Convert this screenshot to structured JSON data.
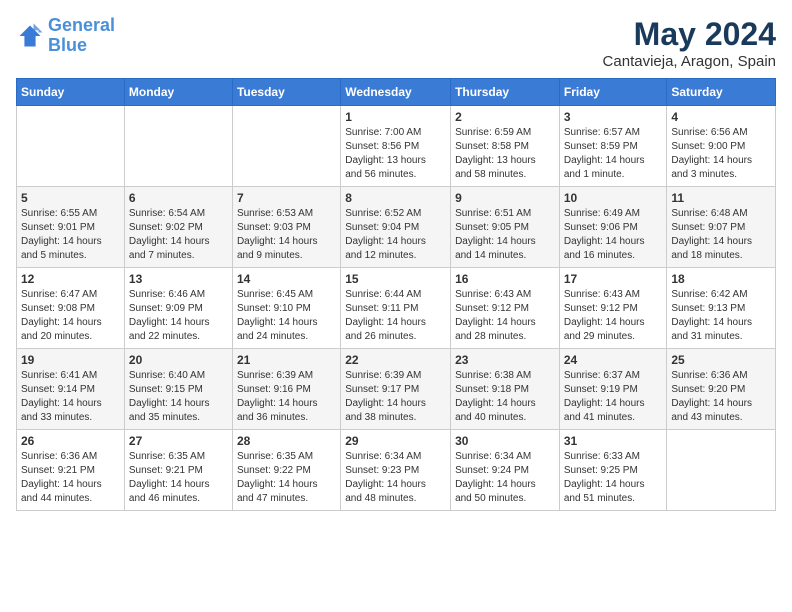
{
  "header": {
    "logo_line1": "General",
    "logo_line2": "Blue",
    "month_title": "May 2024",
    "location": "Cantavieja, Aragon, Spain"
  },
  "days_of_week": [
    "Sunday",
    "Monday",
    "Tuesday",
    "Wednesday",
    "Thursday",
    "Friday",
    "Saturday"
  ],
  "weeks": [
    [
      {
        "day": "",
        "info": ""
      },
      {
        "day": "",
        "info": ""
      },
      {
        "day": "",
        "info": ""
      },
      {
        "day": "1",
        "info": "Sunrise: 7:00 AM\nSunset: 8:56 PM\nDaylight: 13 hours\nand 56 minutes."
      },
      {
        "day": "2",
        "info": "Sunrise: 6:59 AM\nSunset: 8:58 PM\nDaylight: 13 hours\nand 58 minutes."
      },
      {
        "day": "3",
        "info": "Sunrise: 6:57 AM\nSunset: 8:59 PM\nDaylight: 14 hours\nand 1 minute."
      },
      {
        "day": "4",
        "info": "Sunrise: 6:56 AM\nSunset: 9:00 PM\nDaylight: 14 hours\nand 3 minutes."
      }
    ],
    [
      {
        "day": "5",
        "info": "Sunrise: 6:55 AM\nSunset: 9:01 PM\nDaylight: 14 hours\nand 5 minutes."
      },
      {
        "day": "6",
        "info": "Sunrise: 6:54 AM\nSunset: 9:02 PM\nDaylight: 14 hours\nand 7 minutes."
      },
      {
        "day": "7",
        "info": "Sunrise: 6:53 AM\nSunset: 9:03 PM\nDaylight: 14 hours\nand 9 minutes."
      },
      {
        "day": "8",
        "info": "Sunrise: 6:52 AM\nSunset: 9:04 PM\nDaylight: 14 hours\nand 12 minutes."
      },
      {
        "day": "9",
        "info": "Sunrise: 6:51 AM\nSunset: 9:05 PM\nDaylight: 14 hours\nand 14 minutes."
      },
      {
        "day": "10",
        "info": "Sunrise: 6:49 AM\nSunset: 9:06 PM\nDaylight: 14 hours\nand 16 minutes."
      },
      {
        "day": "11",
        "info": "Sunrise: 6:48 AM\nSunset: 9:07 PM\nDaylight: 14 hours\nand 18 minutes."
      }
    ],
    [
      {
        "day": "12",
        "info": "Sunrise: 6:47 AM\nSunset: 9:08 PM\nDaylight: 14 hours\nand 20 minutes."
      },
      {
        "day": "13",
        "info": "Sunrise: 6:46 AM\nSunset: 9:09 PM\nDaylight: 14 hours\nand 22 minutes."
      },
      {
        "day": "14",
        "info": "Sunrise: 6:45 AM\nSunset: 9:10 PM\nDaylight: 14 hours\nand 24 minutes."
      },
      {
        "day": "15",
        "info": "Sunrise: 6:44 AM\nSunset: 9:11 PM\nDaylight: 14 hours\nand 26 minutes."
      },
      {
        "day": "16",
        "info": "Sunrise: 6:43 AM\nSunset: 9:12 PM\nDaylight: 14 hours\nand 28 minutes."
      },
      {
        "day": "17",
        "info": "Sunrise: 6:43 AM\nSunset: 9:12 PM\nDaylight: 14 hours\nand 29 minutes."
      },
      {
        "day": "18",
        "info": "Sunrise: 6:42 AM\nSunset: 9:13 PM\nDaylight: 14 hours\nand 31 minutes."
      }
    ],
    [
      {
        "day": "19",
        "info": "Sunrise: 6:41 AM\nSunset: 9:14 PM\nDaylight: 14 hours\nand 33 minutes."
      },
      {
        "day": "20",
        "info": "Sunrise: 6:40 AM\nSunset: 9:15 PM\nDaylight: 14 hours\nand 35 minutes."
      },
      {
        "day": "21",
        "info": "Sunrise: 6:39 AM\nSunset: 9:16 PM\nDaylight: 14 hours\nand 36 minutes."
      },
      {
        "day": "22",
        "info": "Sunrise: 6:39 AM\nSunset: 9:17 PM\nDaylight: 14 hours\nand 38 minutes."
      },
      {
        "day": "23",
        "info": "Sunrise: 6:38 AM\nSunset: 9:18 PM\nDaylight: 14 hours\nand 40 minutes."
      },
      {
        "day": "24",
        "info": "Sunrise: 6:37 AM\nSunset: 9:19 PM\nDaylight: 14 hours\nand 41 minutes."
      },
      {
        "day": "25",
        "info": "Sunrise: 6:36 AM\nSunset: 9:20 PM\nDaylight: 14 hours\nand 43 minutes."
      }
    ],
    [
      {
        "day": "26",
        "info": "Sunrise: 6:36 AM\nSunset: 9:21 PM\nDaylight: 14 hours\nand 44 minutes."
      },
      {
        "day": "27",
        "info": "Sunrise: 6:35 AM\nSunset: 9:21 PM\nDaylight: 14 hours\nand 46 minutes."
      },
      {
        "day": "28",
        "info": "Sunrise: 6:35 AM\nSunset: 9:22 PM\nDaylight: 14 hours\nand 47 minutes."
      },
      {
        "day": "29",
        "info": "Sunrise: 6:34 AM\nSunset: 9:23 PM\nDaylight: 14 hours\nand 48 minutes."
      },
      {
        "day": "30",
        "info": "Sunrise: 6:34 AM\nSunset: 9:24 PM\nDaylight: 14 hours\nand 50 minutes."
      },
      {
        "day": "31",
        "info": "Sunrise: 6:33 AM\nSunset: 9:25 PM\nDaylight: 14 hours\nand 51 minutes."
      },
      {
        "day": "",
        "info": ""
      }
    ]
  ]
}
